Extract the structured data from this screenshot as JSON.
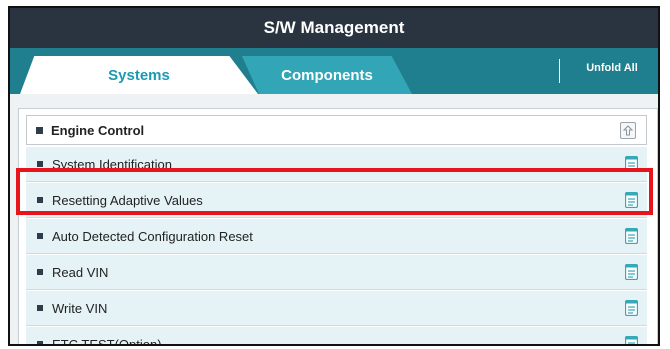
{
  "window": {
    "title": "S/W Management"
  },
  "tabs": [
    {
      "label": "Systems",
      "active": true
    },
    {
      "label": "Components",
      "active": false
    }
  ],
  "toolbar": {
    "unfold_all_label": "Unfold All"
  },
  "group": {
    "label": "Engine Control",
    "items": [
      {
        "label": "System Identification",
        "icon": "document-icon"
      },
      {
        "label": "Resetting Adaptive Values",
        "icon": "document-icon",
        "highlighted": true
      },
      {
        "label": "Auto Detected Configuration Reset",
        "icon": "document-icon"
      },
      {
        "label": "Read VIN",
        "icon": "document-icon"
      },
      {
        "label": "Write VIN",
        "icon": "document-icon"
      },
      {
        "label": "ETC TEST(Option)",
        "icon": "document-icon"
      }
    ]
  },
  "colors": {
    "title_bar": "#2a3340",
    "tab_bar": "#1f7f8f",
    "active_tab_text": "#1a9ab0",
    "inactive_tab": "#32a6b6",
    "row_background": "#e5f3f6",
    "highlight_border": "#e8141b"
  }
}
